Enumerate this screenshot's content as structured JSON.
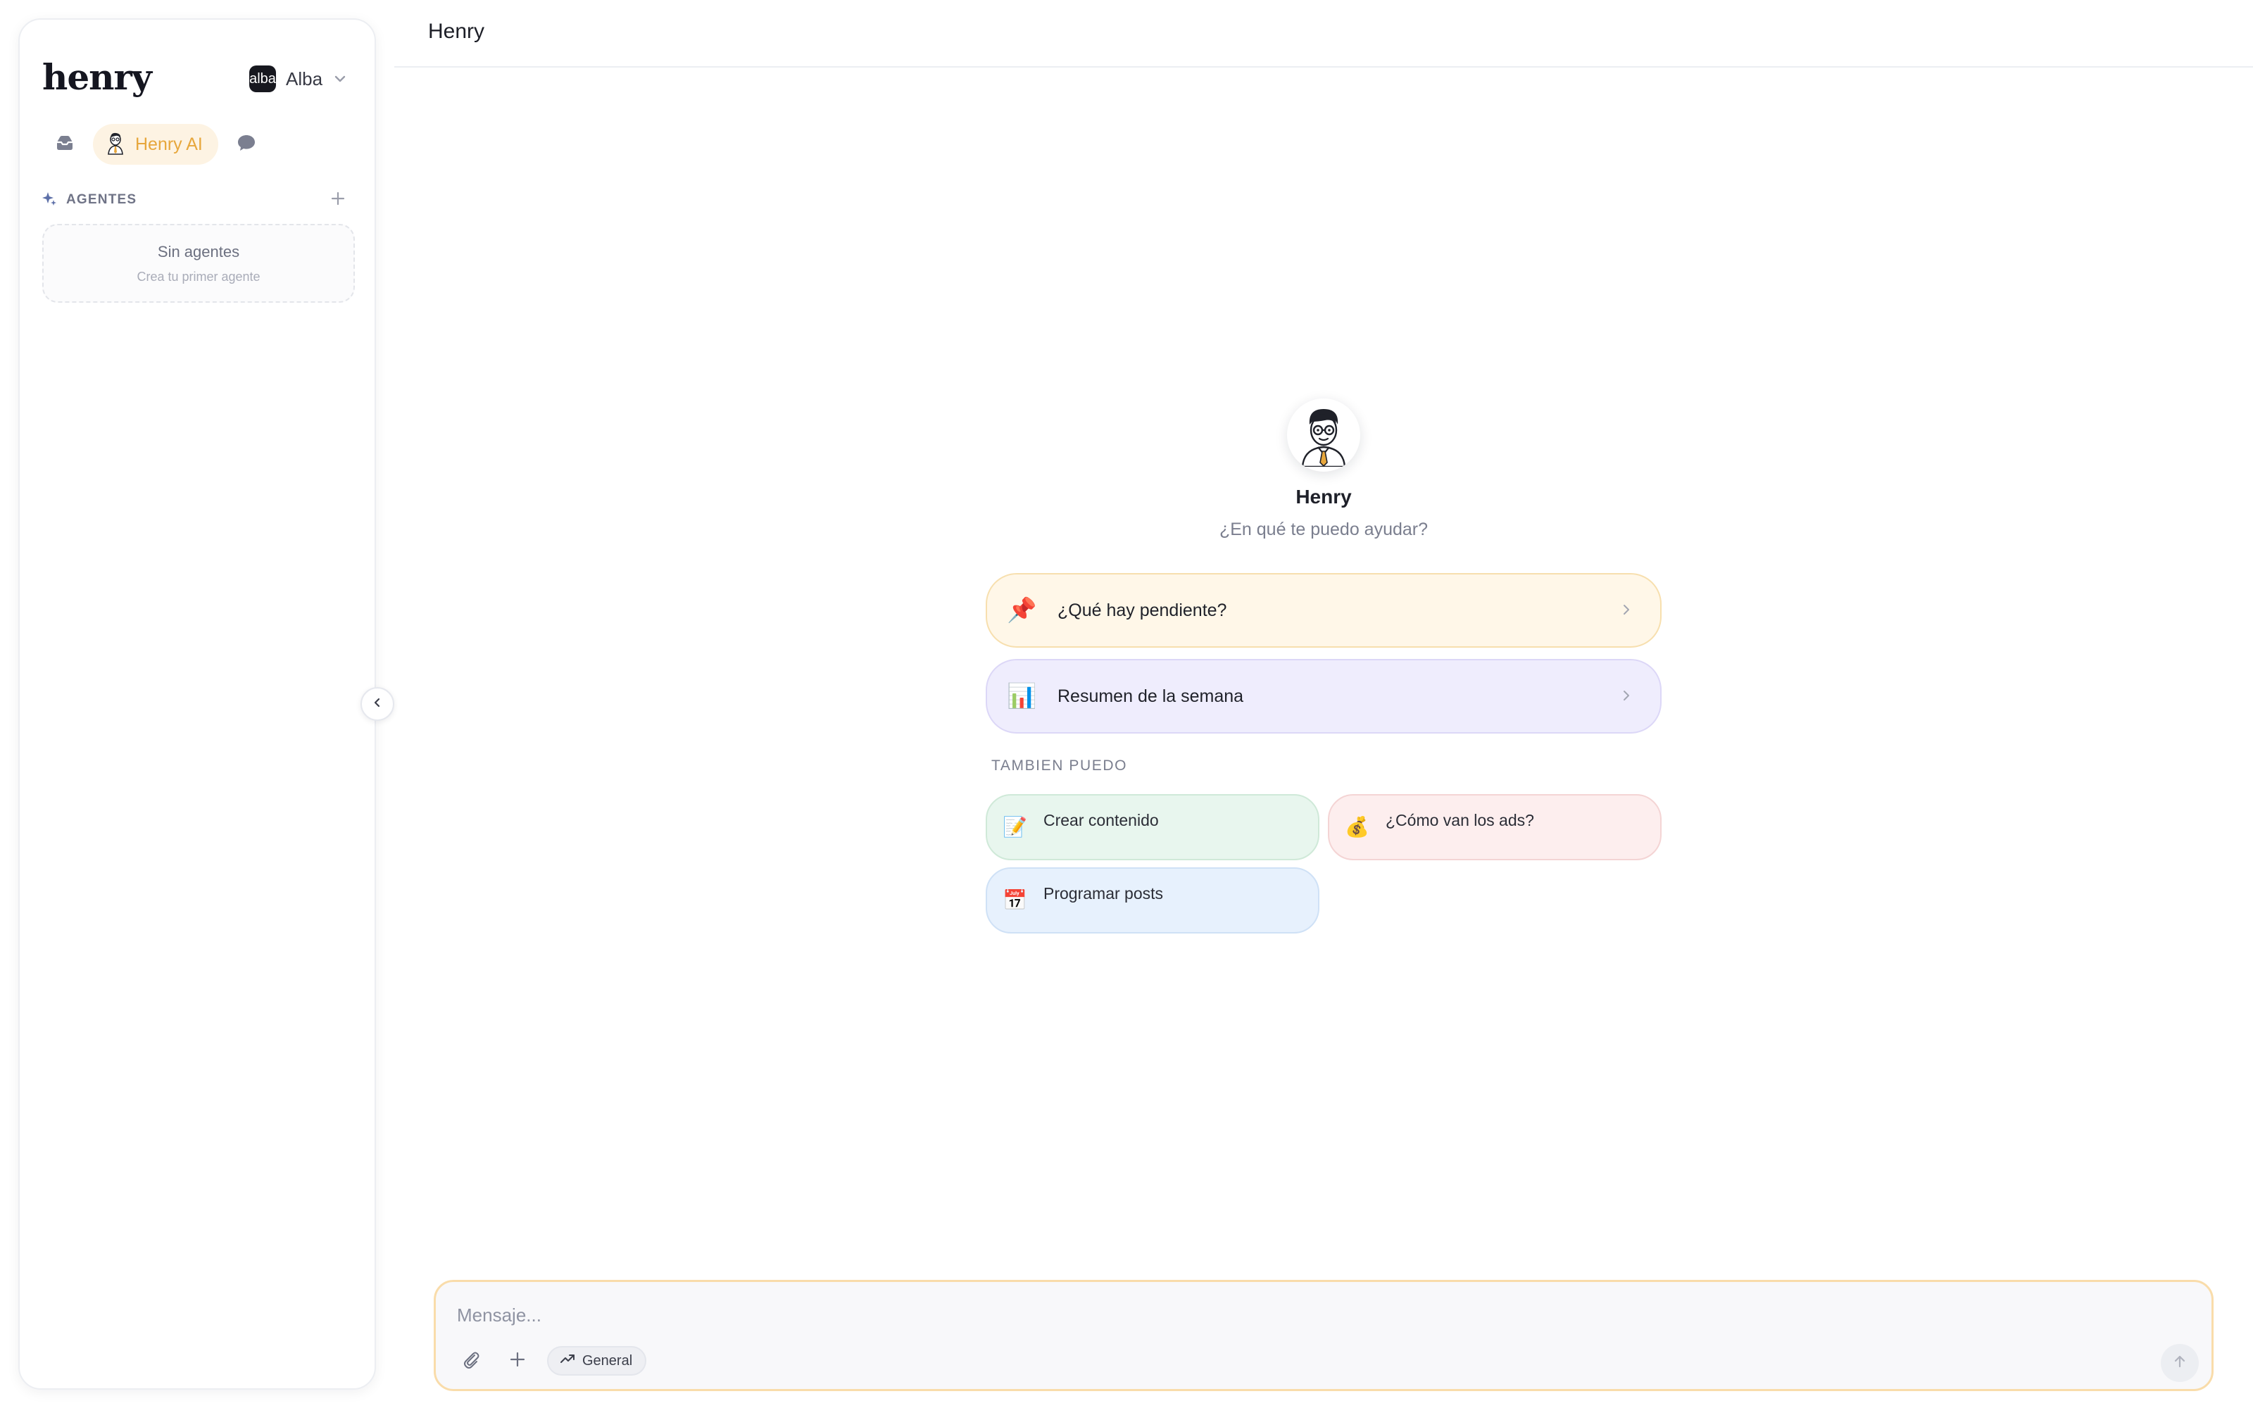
{
  "app": {
    "logo_text": "henry"
  },
  "workspace": {
    "avatar_text": "alba",
    "name": "Alba"
  },
  "nav": {
    "henry_ai_label": "Henry AI"
  },
  "agents": {
    "section_title": "AGENTES",
    "empty_title": "Sin agentes",
    "empty_subtitle": "Crea tu primer agente"
  },
  "header": {
    "title": "Henry"
  },
  "hero": {
    "name": "Henry",
    "subtitle": "¿En qué te puedo ayudar?"
  },
  "suggestions": {
    "primary": [
      {
        "emoji": "📌",
        "label": "¿Qué hay pendiente?"
      },
      {
        "emoji": "📊",
        "label": "Resumen de la semana"
      }
    ],
    "also_label": "TAMBIEN PUEDO",
    "secondary": [
      {
        "emoji": "📝",
        "label": "Crear contenido"
      },
      {
        "emoji": "💰",
        "label": "¿Cómo van los ads?"
      },
      {
        "emoji": "📅",
        "label": "Programar posts"
      }
    ]
  },
  "composer": {
    "placeholder": "Mensaje...",
    "mode_label": "General"
  },
  "colors": {
    "accent": "#e7a73c",
    "accent_bg": "#fdf3e3",
    "composer_border": "#f9dcaa"
  },
  "icons": {
    "inbox": "inbox-icon",
    "henry_avatar": "henry-avatar-icon",
    "chat": "chat-bubble-icon",
    "sparkle": "sparkle-icon",
    "plus": "plus-icon",
    "collapse": "chevron-left-icon",
    "chevron_right": "chevron-right-icon",
    "attach": "paperclip-icon",
    "trend": "trending-up-icon",
    "send": "arrow-up-icon"
  }
}
